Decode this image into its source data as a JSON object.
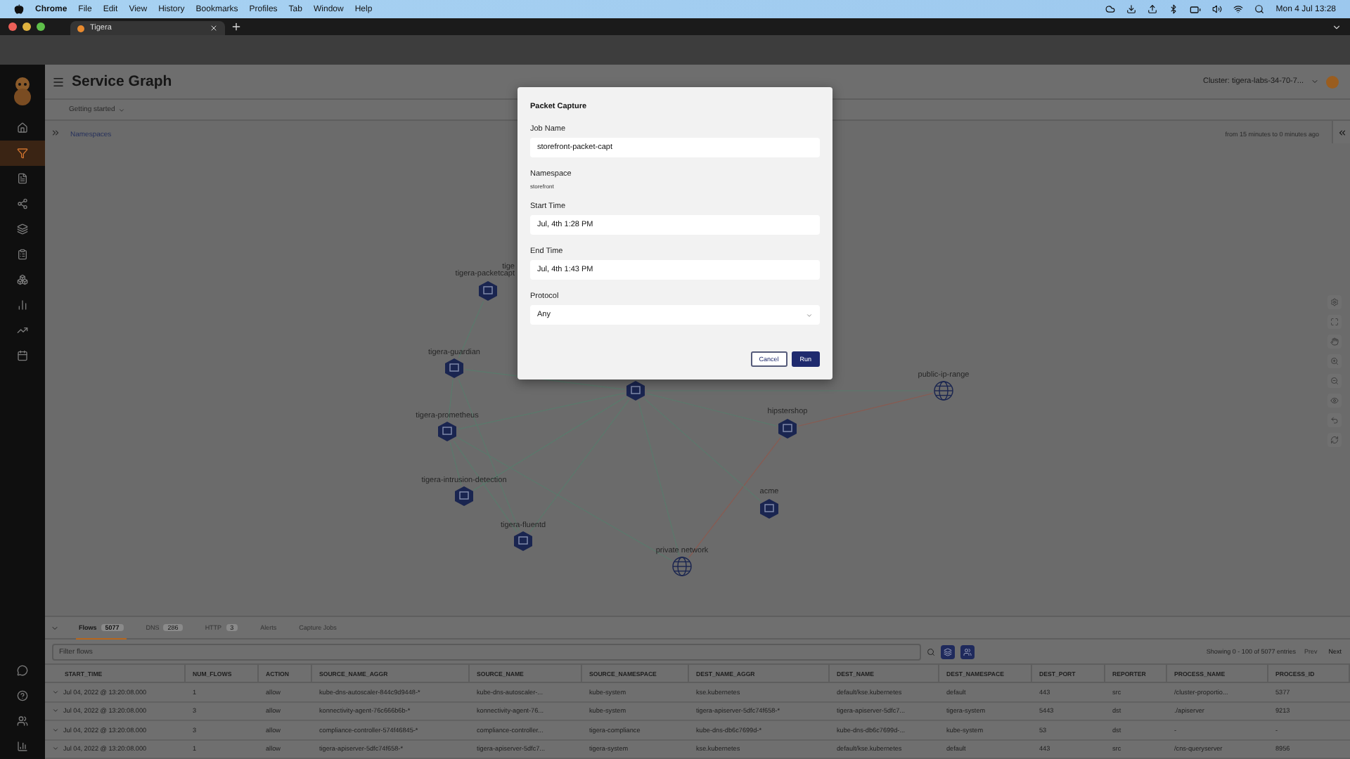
{
  "menubar": {
    "app": "Chrome",
    "items": [
      "File",
      "Edit",
      "View",
      "History",
      "Bookmarks",
      "Profiles",
      "Tab",
      "Window",
      "Help"
    ],
    "clock": "Mon 4 Jul 13:28"
  },
  "browser": {
    "tab": {
      "title": "Tigera"
    }
  },
  "sidebar": {
    "items": [
      {
        "selected": false
      },
      {
        "selected": true
      },
      {
        "selected": false
      },
      {
        "selected": false
      },
      {
        "selected": false
      },
      {
        "selected": false
      },
      {
        "selected": false
      },
      {
        "selected": false
      },
      {
        "selected": false
      },
      {
        "selected": false
      }
    ]
  },
  "header": {
    "title": "Service Graph",
    "cluster": "Cluster: tigera-labs-34-70-7...",
    "menu": "Getting started"
  },
  "graph": {
    "breadcrumb": "Namespaces",
    "time_range": "from 15 minutes to 0 minutes ago",
    "nodes": [
      {
        "label": "tige",
        "kind": "hidden"
      },
      {
        "label": "tigera-packetcapt",
        "kind": "namespace"
      },
      {
        "label": "tigera-guardian",
        "kind": "namespace"
      },
      {
        "kind": "namespace"
      },
      {
        "label": "tigera-prometheus",
        "kind": "namespace"
      },
      {
        "label": "tigera-intrusion-detection",
        "kind": "namespace"
      },
      {
        "label": "tigera-fluentd",
        "kind": "namespace"
      },
      {
        "label": "private network",
        "kind": "network"
      },
      {
        "label": "hipstershop",
        "kind": "namespace"
      },
      {
        "label": "acme",
        "kind": "namespace"
      },
      {
        "label": "public-ip-range",
        "kind": "network"
      }
    ]
  },
  "bottom_panel": {
    "tabs": [
      {
        "label": "Flows",
        "count": "5077",
        "selected": true
      },
      {
        "label": "DNS",
        "count": "286",
        "selected": false
      },
      {
        "label": "HTTP",
        "count": "3",
        "selected": false
      },
      {
        "label": "Alerts",
        "selected": false
      },
      {
        "label": "Capture Jobs",
        "selected": false
      }
    ],
    "filter": {
      "placeholder": "Filter flows"
    },
    "summary": "Showing 0 - 100 of 5077 entries",
    "prev": "Prev",
    "next": "Next"
  },
  "table": {
    "columns": [
      "START_TIME",
      "NUM_FLOWS",
      "ACTION",
      "SOURCE_NAME_AGGR",
      "SOURCE_NAME",
      "SOURCE_NAMESPACE",
      "DEST_NAME_AGGR",
      "DEST_NAME",
      "DEST_NAMESPACE",
      "DEST_PORT",
      "REPORTER",
      "PROCESS_NAME",
      "PROCESS_ID"
    ],
    "rows": [
      [
        "Jul 04, 2022 @ 13:20:08.000",
        "1",
        "allow",
        "kube-dns-autoscaler-844c9d9448-*",
        "kube-dns-autoscaler-...",
        "kube-system",
        "kse.kubernetes",
        "default/kse.kubernetes",
        "default",
        "443",
        "src",
        "/cluster-proportio...",
        "5377"
      ],
      [
        "Jul 04, 2022 @ 13:20:08.000",
        "3",
        "allow",
        "konnectivity-agent-76c666b6b-*",
        "konnectivity-agent-76...",
        "kube-system",
        "tigera-apiserver-5dfc74f658-*",
        "tigera-apiserver-5dfc7...",
        "tigera-system",
        "5443",
        "dst",
        "./apiserver",
        "9213"
      ],
      [
        "Jul 04, 2022 @ 13:20:08.000",
        "3",
        "allow",
        "compliance-controller-574f46845-*",
        "compliance-controller...",
        "tigera-compliance",
        "kube-dns-db6c7699d-*",
        "kube-dns-db6c7699d-...",
        "kube-system",
        "53",
        "dst",
        "-",
        "-"
      ],
      [
        "Jul 04, 2022 @ 13:20:08.000",
        "1",
        "allow",
        "tigera-apiserver-5dfc74f658-*",
        "tigera-apiserver-5dfc7...",
        "tigera-system",
        "kse.kubernetes",
        "default/kse.kubernetes",
        "default",
        "443",
        "src",
        "/cns-queryserver",
        "8956"
      ]
    ]
  },
  "dialog": {
    "title": "Packet Capture",
    "fields": [
      {
        "label": "Job Name",
        "kind": "input",
        "value": "storefront-packet-capt"
      },
      {
        "label": "Namespace",
        "kind": "text",
        "value": "storefront"
      },
      {
        "label": "Start Time",
        "kind": "input",
        "value": "Jul, 4th 1:28 PM"
      },
      {
        "label": "End Time",
        "kind": "input",
        "value": "Jul, 4th 1:43 PM"
      },
      {
        "label": "Protocol",
        "kind": "select",
        "value": "Any"
      }
    ],
    "buttons": [
      {
        "label": "Cancel",
        "kind": "secondary"
      },
      {
        "label": "Run",
        "kind": "primary"
      }
    ]
  }
}
